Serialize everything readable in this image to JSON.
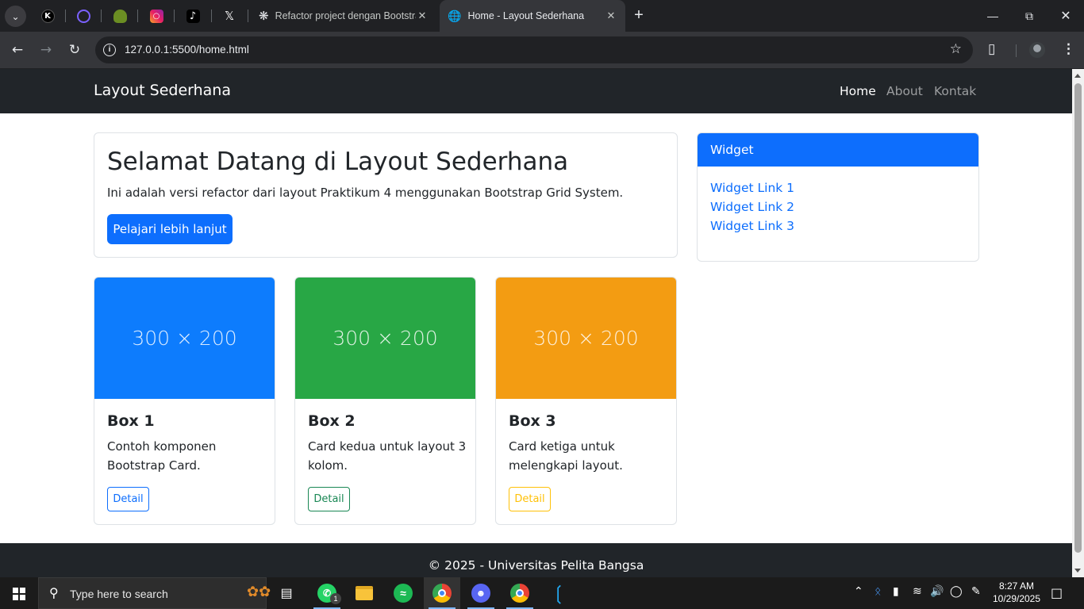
{
  "browser": {
    "tabs": [
      {
        "title": "Refactor project dengan Bootstrap",
        "active": false
      },
      {
        "title": "Home - Layout Sederhana",
        "active": true
      }
    ],
    "url": "127.0.0.1:5500/home.html"
  },
  "page": {
    "brand": "Layout Sederhana",
    "nav": [
      "Home",
      "About",
      "Kontak"
    ],
    "hero": {
      "title": "Selamat Datang di Layout Sederhana",
      "text": "Ini adalah versi refactor dari layout Praktikum 4 menggunakan Bootstrap Grid System.",
      "button": "Pelajari lebih lanjut"
    },
    "widget": {
      "title": "Widget",
      "links": [
        "Widget Link 1",
        "Widget Link 2",
        "Widget Link 3"
      ]
    },
    "boxes": [
      {
        "image_label": "300 × 200",
        "title": "Box 1",
        "text": "Contoh komponen Bootstrap Card.",
        "button": "Detail",
        "color": "#0d6efd"
      },
      {
        "image_label": "300 × 200",
        "title": "Box 2",
        "text": "Card kedua untuk layout 3 kolom.",
        "button": "Detail",
        "color": "#28a745"
      },
      {
        "image_label": "300 × 200",
        "title": "Box 3",
        "text": "Card ketiga untuk melengkapi layout.",
        "button": "Detail",
        "color": "#f39c12"
      }
    ],
    "footer": "© 2025 - Universitas Pelita Bangsa"
  },
  "taskbar": {
    "search_placeholder": "Type here to search",
    "time": "8:27 AM",
    "date": "10/29/2025",
    "whatsapp_badge": "1"
  },
  "colors": {
    "primary": "#0d6efd",
    "success": "#198754",
    "warning": "#ffc107",
    "dark": "#212529"
  }
}
